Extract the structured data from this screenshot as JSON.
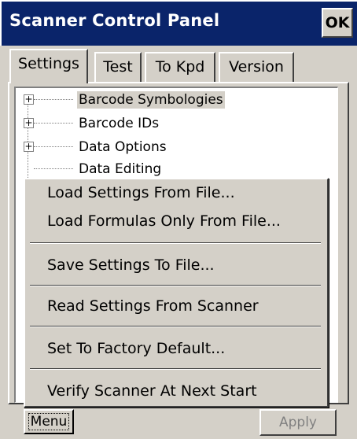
{
  "window": {
    "title": "Scanner Control Panel",
    "ok_label": "OK",
    "title_bar_color": "#0a246a"
  },
  "tabs": [
    {
      "label": "Settings",
      "active": true
    },
    {
      "label": "Test",
      "active": false
    },
    {
      "label": "To Kpd",
      "active": false
    },
    {
      "label": "Version",
      "active": false
    }
  ],
  "tree": {
    "items": [
      {
        "label": "Barcode Symbologies",
        "expandable": true,
        "selected": true
      },
      {
        "label": "Barcode IDs",
        "expandable": true,
        "selected": false
      },
      {
        "label": "Data Options",
        "expandable": true,
        "selected": false
      },
      {
        "label": "Data Editing",
        "expandable": false,
        "selected": false
      }
    ]
  },
  "menu": {
    "items": [
      {
        "label": "Load Settings From File..."
      },
      {
        "label": "Load Formulas Only From File..."
      },
      {
        "label": "Save Settings To File..."
      },
      {
        "label": "Read Settings From Scanner"
      },
      {
        "label": "Set To Factory Default..."
      },
      {
        "label": "Verify Scanner At Next Start"
      }
    ]
  },
  "buttons": {
    "menu_label": "Menu",
    "apply_label": "Apply",
    "apply_enabled": false
  },
  "icons": {
    "expander": "plus-box-icon",
    "ok": "ok-button"
  }
}
